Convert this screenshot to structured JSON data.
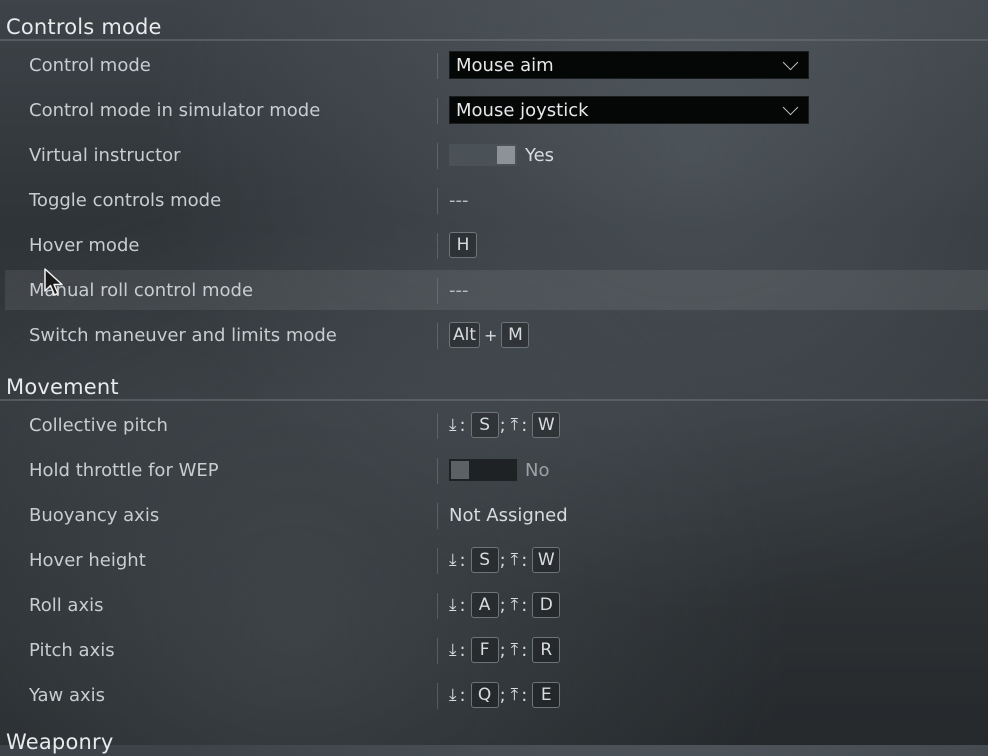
{
  "sections": {
    "controls_mode": "Controls mode",
    "movement": "Movement",
    "weaponry": "Weaponry"
  },
  "rows": {
    "control_mode": {
      "label": "Control mode",
      "value": "Mouse aim"
    },
    "control_mode_sim": {
      "label": "Control mode in simulator mode",
      "value": "Mouse joystick"
    },
    "virtual_instructor": {
      "label": "Virtual instructor",
      "value": "Yes"
    },
    "toggle_controls_mode": {
      "label": "Toggle controls mode",
      "value": "---"
    },
    "hover_mode": {
      "label": "Hover mode",
      "key": "H"
    },
    "manual_roll": {
      "label": "Manual roll control mode",
      "value": "---"
    },
    "switch_maneuver": {
      "label": "Switch maneuver and limits mode",
      "key1": "Alt",
      "plus": "+",
      "key2": "M"
    },
    "collective_pitch": {
      "label": "Collective pitch",
      "dec": "S",
      "inc": "W"
    },
    "hold_throttle": {
      "label": "Hold throttle for WEP",
      "value": "No"
    },
    "buoyancy_axis": {
      "label": "Buoyancy axis",
      "value": "Not Assigned"
    },
    "hover_height": {
      "label": "Hover height",
      "dec": "S",
      "inc": "W"
    },
    "roll_axis": {
      "label": "Roll axis",
      "dec": "A",
      "inc": "D"
    },
    "pitch_axis": {
      "label": "Pitch axis",
      "dec": "F",
      "inc": "R"
    },
    "yaw_axis": {
      "label": "Yaw axis",
      "dec": "Q",
      "inc": "E"
    }
  },
  "glyphs": {
    "decrease": "⤓",
    "increase": "⤒",
    "colon": ":",
    "semicolon": ";"
  },
  "icons": [
    "chevron-down-icon",
    "axis-decrease-icon",
    "axis-increase-icon",
    "mouse-cursor-icon"
  ]
}
